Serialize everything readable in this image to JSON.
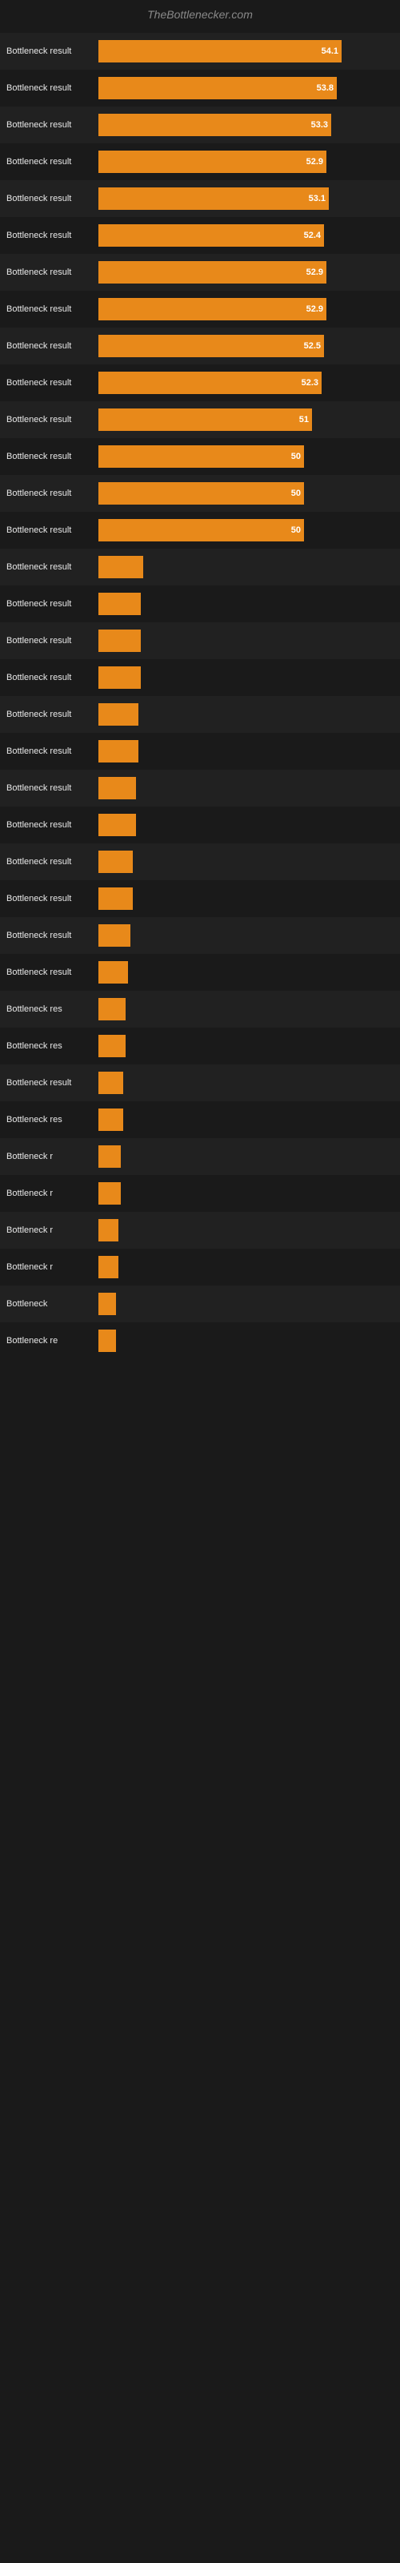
{
  "header": {
    "title": "TheBottlenecker.com"
  },
  "bars": [
    {
      "label": "Bottleneck result",
      "value": 54.1,
      "width_pct": 98
    },
    {
      "label": "Bottleneck result",
      "value": 53.8,
      "width_pct": 96
    },
    {
      "label": "Bottleneck result",
      "value": 53.3,
      "width_pct": 94
    },
    {
      "label": "Bottleneck result",
      "value": 52.9,
      "width_pct": 92
    },
    {
      "label": "Bottleneck result",
      "value": 53.1,
      "width_pct": 93
    },
    {
      "label": "Bottleneck result",
      "value": 52.4,
      "width_pct": 91
    },
    {
      "label": "Bottleneck result",
      "value": 52.9,
      "width_pct": 92
    },
    {
      "label": "Bottleneck result",
      "value": 52.9,
      "width_pct": 92
    },
    {
      "label": "Bottleneck result",
      "value": 52.5,
      "width_pct": 91
    },
    {
      "label": "Bottleneck result",
      "value": 52.3,
      "width_pct": 90
    },
    {
      "label": "Bottleneck result",
      "value": 51.0,
      "width_pct": 86
    },
    {
      "label": "Bottleneck result",
      "value": 50.0,
      "width_pct": 83
    },
    {
      "label": "Bottleneck result",
      "value": 50.0,
      "width_pct": 83
    },
    {
      "label": "Bottleneck result",
      "value": 50.0,
      "width_pct": 83
    },
    {
      "label": "Bottleneck result",
      "value": null,
      "width_pct": 18
    },
    {
      "label": "Bottleneck result",
      "value": null,
      "width_pct": 17
    },
    {
      "label": "Bottleneck result",
      "value": null,
      "width_pct": 17
    },
    {
      "label": "Bottleneck result",
      "value": null,
      "width_pct": 17
    },
    {
      "label": "Bottleneck result",
      "value": null,
      "width_pct": 16
    },
    {
      "label": "Bottleneck result",
      "value": null,
      "width_pct": 16
    },
    {
      "label": "Bottleneck result",
      "value": null,
      "width_pct": 15
    },
    {
      "label": "Bottleneck result",
      "value": null,
      "width_pct": 15
    },
    {
      "label": "Bottleneck result",
      "value": null,
      "width_pct": 14
    },
    {
      "label": "Bottleneck result",
      "value": null,
      "width_pct": 14
    },
    {
      "label": "Bottleneck result",
      "value": null,
      "width_pct": 13
    },
    {
      "label": "Bottleneck result",
      "value": null,
      "width_pct": 12
    },
    {
      "label": "Bottleneck res",
      "value": null,
      "width_pct": 11
    },
    {
      "label": "Bottleneck res",
      "value": null,
      "width_pct": 11
    },
    {
      "label": "Bottleneck result",
      "value": null,
      "width_pct": 10
    },
    {
      "label": "Bottleneck res",
      "value": null,
      "width_pct": 10
    },
    {
      "label": "Bottleneck r",
      "value": null,
      "width_pct": 9
    },
    {
      "label": "Bottleneck r",
      "value": null,
      "width_pct": 9
    },
    {
      "label": "Bottleneck r",
      "value": null,
      "width_pct": 8
    },
    {
      "label": "Bottleneck r",
      "value": null,
      "width_pct": 8
    },
    {
      "label": "Bottleneck",
      "value": null,
      "width_pct": 7
    },
    {
      "label": "Bottleneck re",
      "value": null,
      "width_pct": 7
    }
  ]
}
